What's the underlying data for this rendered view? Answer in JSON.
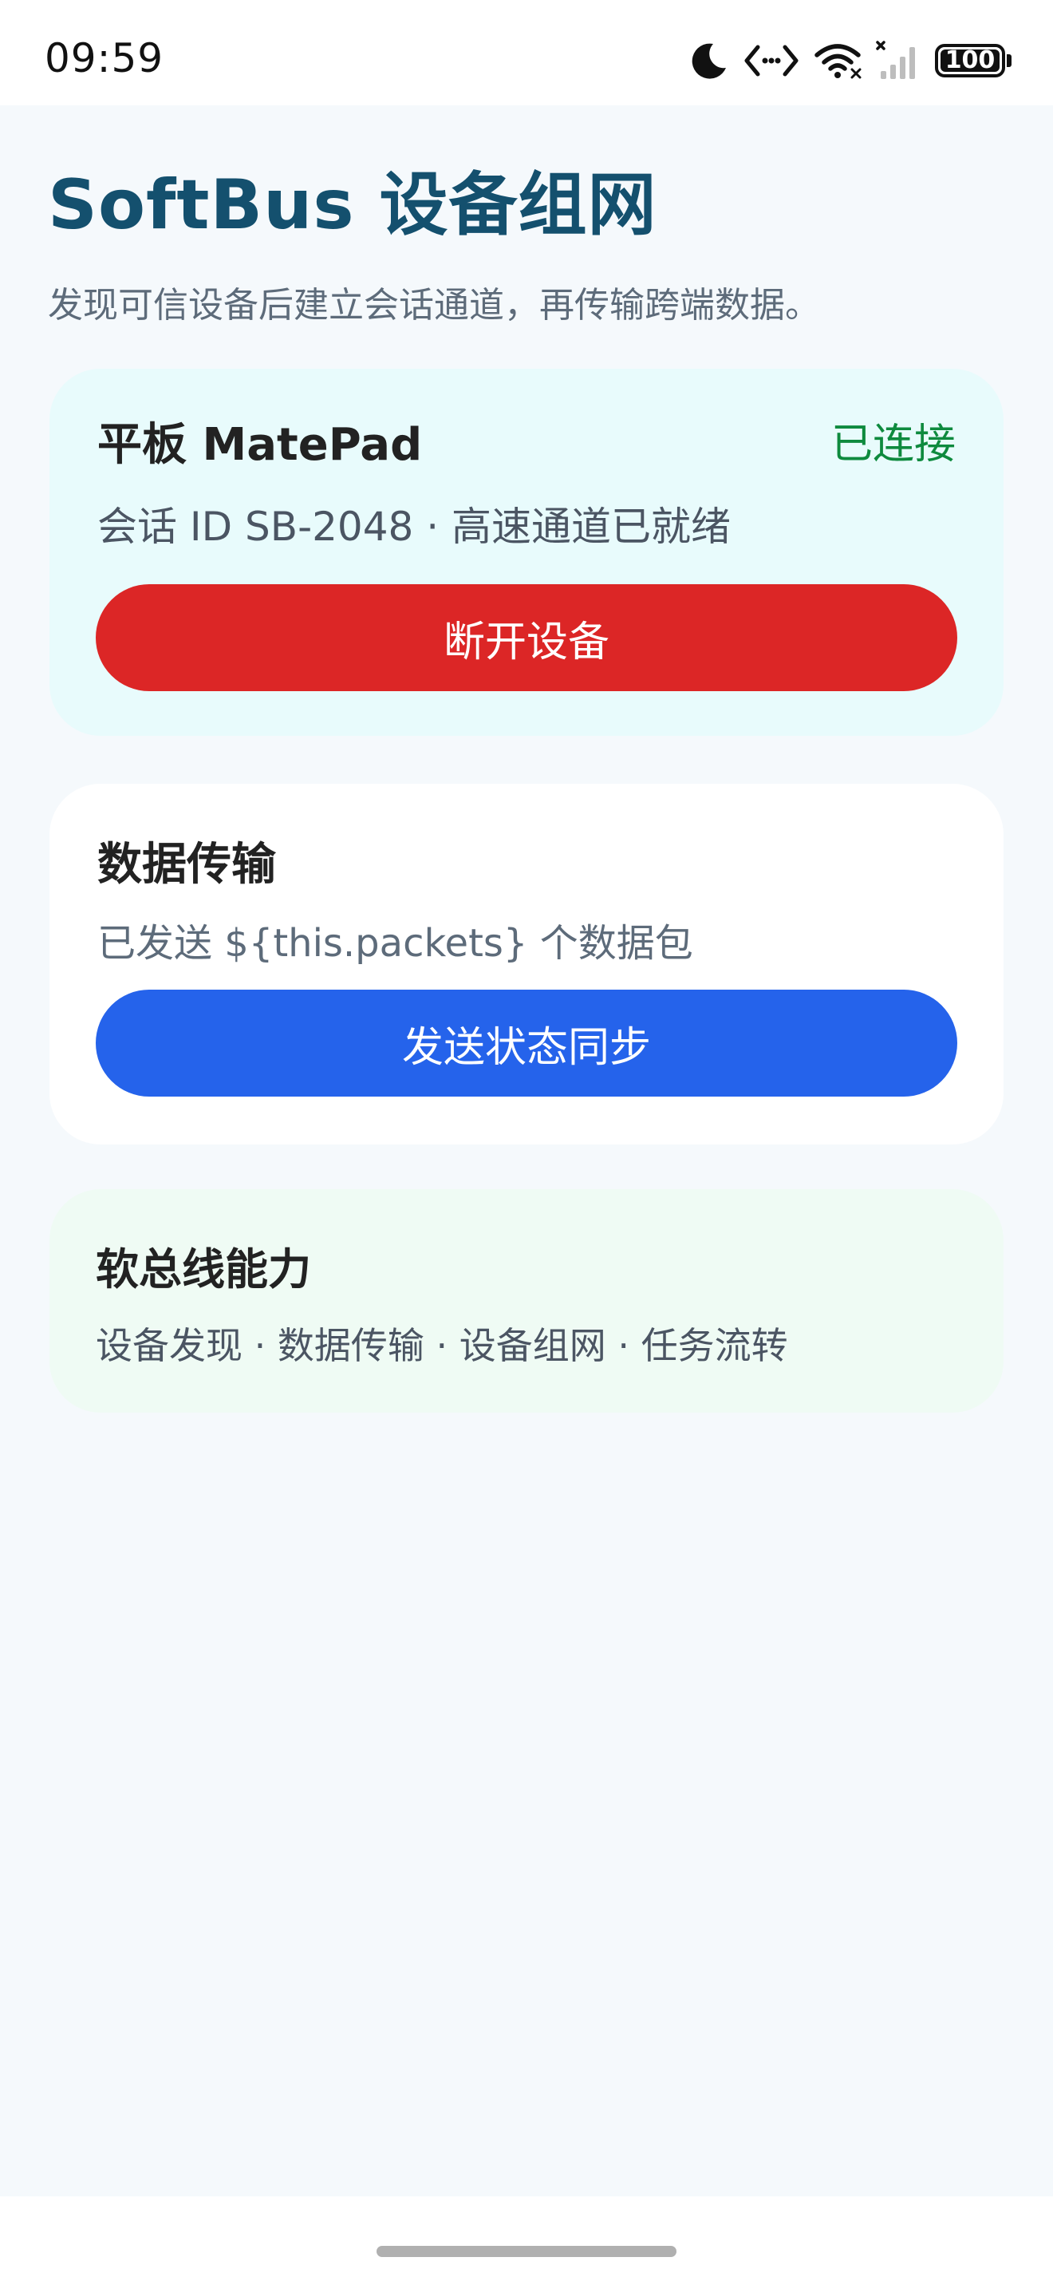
{
  "status_bar": {
    "time": "09:59",
    "battery_level": "100",
    "icons": [
      "moon-icon",
      "code-arrows-icon",
      "wifi-icon",
      "signal-no-sim-icon",
      "battery-icon"
    ]
  },
  "header": {
    "title": "SoftBus 设备组网",
    "subtitle": "发现可信设备后建立会话通道，再传输跨端数据。"
  },
  "device_card": {
    "name": "平板 MatePad",
    "status": "已连接",
    "session": "会话 ID SB-2048 · 高速通道已就绪",
    "disconnect_label": "断开设备"
  },
  "transfer_card": {
    "title": "数据传输",
    "count_text": "已发送 ${this.packets} 个数据包",
    "sync_label": "发送状态同步"
  },
  "capability_card": {
    "title": "软总线能力",
    "list": "设备发现 · 数据传输 · 设备组网 · 任务流转"
  },
  "colors": {
    "title": "#14506e",
    "connected": "#0e8a3e",
    "danger": "#dc2626",
    "primary": "#2563eb",
    "device_card_bg": "#e8fbfc",
    "capability_card_bg": "#effbf4",
    "page_bg": "#f5f9fc"
  }
}
